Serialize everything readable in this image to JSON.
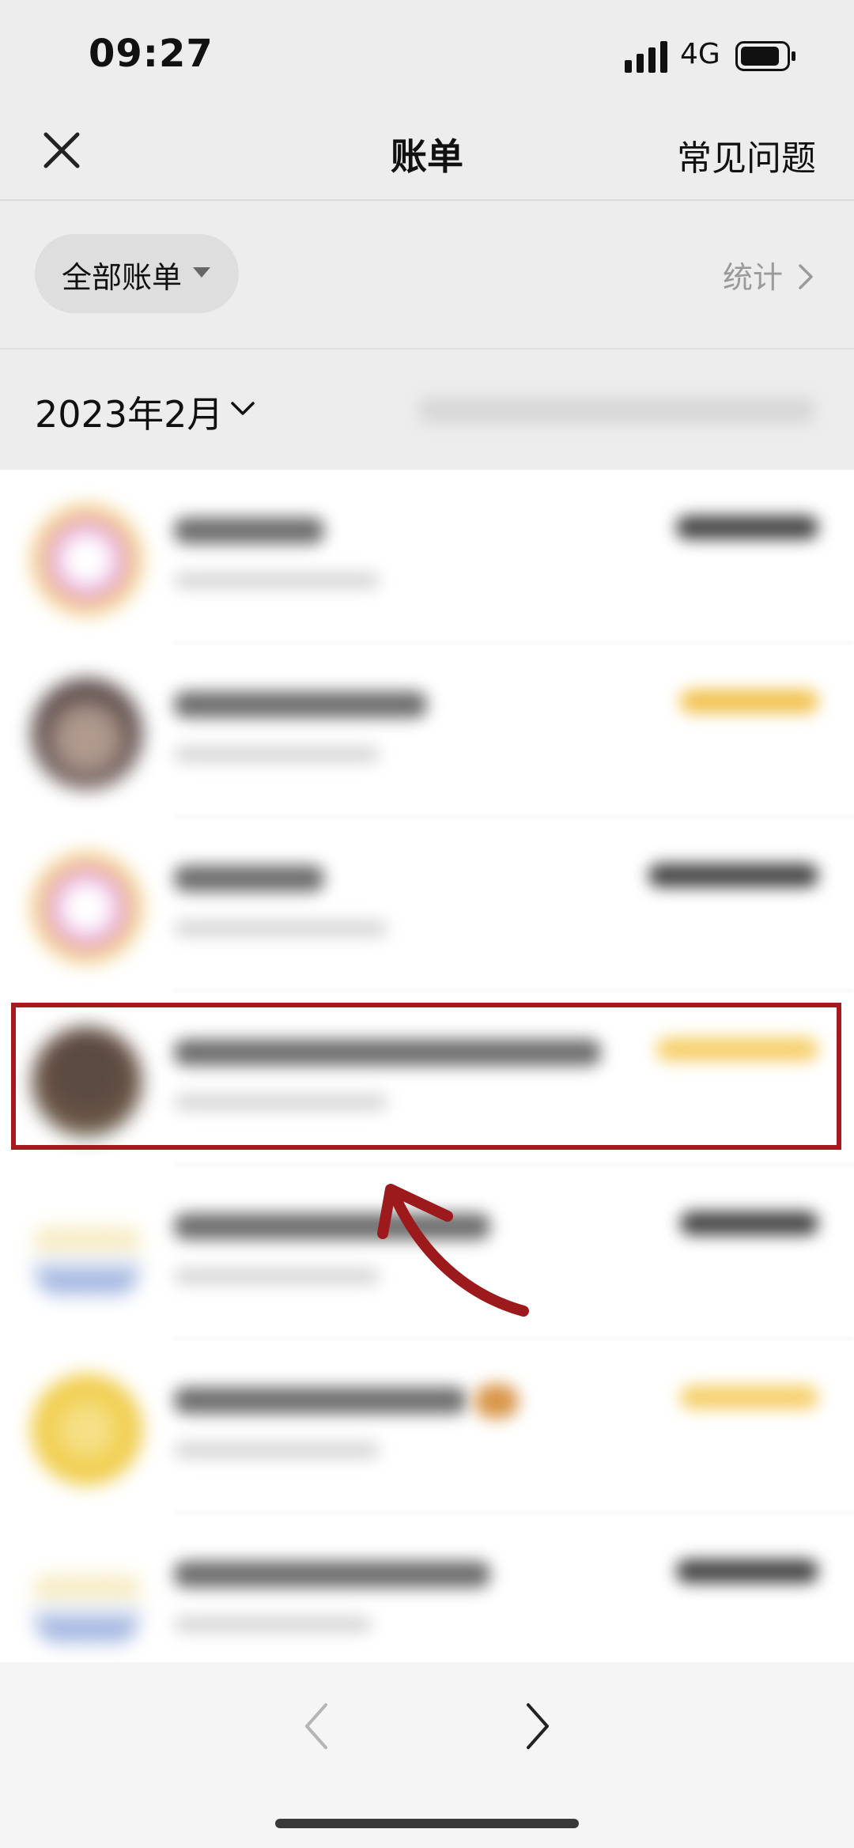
{
  "status_bar": {
    "time": "09:27",
    "network": "4G",
    "icons": [
      "signal-icon",
      "battery-icon"
    ]
  },
  "nav": {
    "title": "账单",
    "faq_label": "常见问题",
    "close_icon": "close-icon"
  },
  "filter": {
    "label": "全部账单",
    "stats_label": "统计",
    "caret_icon": "caret-down-icon",
    "stats_icon": "chevron-right-icon"
  },
  "month": {
    "label": "2023年2月",
    "icon": "chevron-down-icon"
  },
  "transactions": [
    {
      "avatar_style": "ring",
      "avatar_colors": [
        "#e6a6e0",
        "#f3d26b"
      ],
      "amount_color": "#444444"
    },
    {
      "avatar_style": "dark",
      "avatar_colors": [
        "#5a4a48",
        "#b09a8e"
      ],
      "amount_color": "#f2c24f"
    },
    {
      "avatar_style": "ring",
      "avatar_colors": [
        "#e6a6e0",
        "#f3d26b"
      ],
      "amount_color": "#444444"
    },
    {
      "avatar_style": "dark",
      "avatar_colors": [
        "#6a5244",
        "#7c8a70"
      ],
      "amount_color": "#f5cf6a"
    },
    {
      "avatar_style": "logo",
      "avatar_colors": [
        "#f3e3a8",
        "#8aa2d8"
      ],
      "amount_color": "#444444"
    },
    {
      "avatar_style": "solid",
      "avatar_colors": [
        "#f0cd49",
        "#f6e08a"
      ],
      "amount_color": "#f5cf6a"
    },
    {
      "avatar_style": "logo",
      "avatar_colors": [
        "#f3e3a8",
        "#8aa2d8"
      ],
      "amount_color": "#444444"
    }
  ],
  "annotation": {
    "highlight_color": "#a8181c",
    "highlighted_index": 3
  },
  "pager": {
    "prev_icon": "chevron-left-icon",
    "next_icon": "chevron-right-icon"
  }
}
